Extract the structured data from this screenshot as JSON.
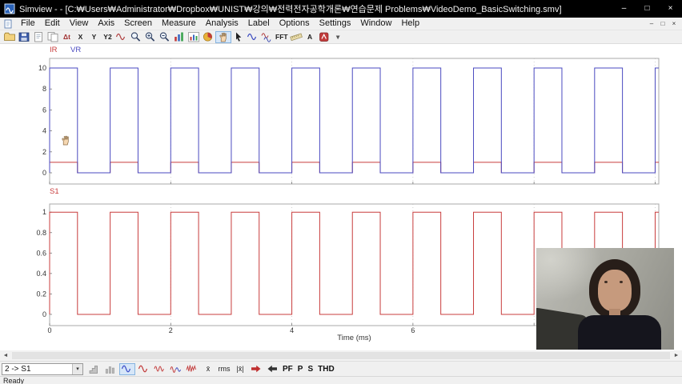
{
  "window": {
    "title": "Simview -  - [C:₩Users₩Administrator₩Dropbox₩UNIST₩강의₩전력전자공학개론₩연습문제 Problems₩VideoDemo_BasicSwitching.smv]",
    "controls": {
      "minimize": "–",
      "maximize": "□",
      "close": "×"
    }
  },
  "menubar": {
    "items": [
      "File",
      "Edit",
      "View",
      "Axis",
      "Screen",
      "Measure",
      "Analysis",
      "Label",
      "Options",
      "Settings",
      "Window",
      "Help"
    ],
    "mdi_controls": {
      "minimize": "–",
      "restore": "□",
      "close": "×"
    }
  },
  "toolbar": {
    "icons": [
      {
        "name": "open-icon",
        "kind": "folder"
      },
      {
        "name": "save-icon",
        "kind": "disk"
      },
      {
        "name": "print-icon",
        "kind": "page"
      },
      {
        "name": "copy-icon",
        "kind": "page2"
      },
      {
        "name": "measure-icon",
        "kind": "text",
        "label": "Δt",
        "color": "#a03030"
      },
      {
        "name": "x-axis-icon",
        "kind": "text",
        "label": "X",
        "color": "#202020"
      },
      {
        "name": "y-axis-icon",
        "kind": "text",
        "label": "Y",
        "color": "#202020"
      },
      {
        "name": "y2-axis-icon",
        "kind": "text",
        "label": "Y2",
        "color": "#202020"
      },
      {
        "name": "add-curve-icon",
        "kind": "wave",
        "color": "#b04040"
      },
      {
        "name": "zoom-icon",
        "kind": "mag"
      },
      {
        "name": "zoom-in-icon",
        "kind": "magplus"
      },
      {
        "name": "zoom-out-icon",
        "kind": "magminus"
      },
      {
        "name": "redraw-icon",
        "kind": "bars"
      },
      {
        "name": "add-screen-icon",
        "kind": "bars2"
      },
      {
        "name": "pie-view-icon",
        "kind": "pie"
      },
      {
        "name": "hand-pan-icon",
        "kind": "hand",
        "selected": true
      },
      {
        "name": "pointer-icon",
        "kind": "cursor"
      },
      {
        "name": "overlay-curve-icon",
        "kind": "wave",
        "color": "#3a4ac0"
      },
      {
        "name": "dual-curve-icon",
        "kind": "wave2"
      },
      {
        "name": "fft-icon",
        "kind": "text",
        "label": "FFT",
        "color": "#202020"
      },
      {
        "name": "ruler-icon",
        "kind": "ruler"
      },
      {
        "name": "text-label-icon",
        "kind": "text",
        "label": "A",
        "color": "#202020"
      },
      {
        "name": "phase-icon",
        "kind": "badge"
      },
      {
        "name": "toolbar-overflow-icon",
        "kind": "text",
        "label": "▾",
        "color": "#555555"
      }
    ]
  },
  "chart_data": [
    {
      "type": "line",
      "screen": "top",
      "title": "",
      "legend": [
        {
          "label": "IR",
          "color": "#c83c3c"
        },
        {
          "label": "VR",
          "color": "#4a4ac0"
        }
      ],
      "xlabel": "",
      "x_unit": "ms",
      "xlim": [
        0,
        10.06
      ],
      "ylim": [
        -1.07,
        10.92
      ],
      "yticks": [
        0,
        2,
        4,
        6,
        8,
        10
      ],
      "xticks": [
        0,
        2,
        4,
        6,
        8,
        10
      ],
      "grid_x": [
        2,
        4,
        6,
        8,
        10
      ],
      "series": [
        {
          "name": "IR",
          "color": "#c83c3c",
          "waveform": "square",
          "low": 0,
          "high": 1,
          "period_ms": 1.0,
          "duty": 0.46,
          "start_state": "high"
        },
        {
          "name": "VR",
          "color": "#4a4ac0",
          "waveform": "square",
          "low": 0,
          "high": 10,
          "period_ms": 1.0,
          "duty": 0.46,
          "start_state": "high"
        }
      ]
    },
    {
      "type": "line",
      "screen": "bottom",
      "title": "",
      "legend": [
        {
          "label": "S1",
          "color": "#c83c3c"
        }
      ],
      "xlabel": "Time (ms)",
      "x_unit": "ms",
      "xlim": [
        0,
        10.06
      ],
      "ylim": [
        -0.11,
        1.08
      ],
      "yticks": [
        0,
        0.2,
        0.4,
        0.6,
        0.8,
        1
      ],
      "xticks": [
        0,
        2,
        4,
        6,
        8,
        10
      ],
      "xtick_labels": [
        "0",
        "2",
        "4",
        "6"
      ],
      "grid_x": [
        2,
        4,
        6,
        8,
        10
      ],
      "series": [
        {
          "name": "S1",
          "color": "#c83c3c",
          "waveform": "square",
          "low": 0,
          "high": 1,
          "period_ms": 1.0,
          "duty": 0.46,
          "start_state": "high"
        }
      ]
    }
  ],
  "bottom_toolbar": {
    "combo": {
      "value": "2 -> S1",
      "dropdown_icon": "▾"
    },
    "icons": [
      {
        "name": "bar-display-icon",
        "kind": "graybars"
      },
      {
        "name": "stacked-display-icon",
        "kind": "graybars2"
      },
      {
        "name": "sine-display-icon",
        "kind": "sine",
        "color": "#3a4ac8",
        "selected": true
      },
      {
        "name": "waveform-red-icon",
        "kind": "sine",
        "color": "#c23a3a"
      },
      {
        "name": "waveform-double-icon",
        "kind": "sine2",
        "color": "#c23a3a"
      },
      {
        "name": "waveform-mixed-icon",
        "kind": "mixwave"
      },
      {
        "name": "waveform-noise-icon",
        "kind": "noise"
      },
      {
        "name": "mean-icon",
        "kind": "text",
        "label": "x̄"
      },
      {
        "name": "rms-icon",
        "kind": "text",
        "label": "rms"
      },
      {
        "name": "abs-mean-icon",
        "kind": "text",
        "label": "|x̄|"
      },
      {
        "name": "next-page-icon",
        "kind": "arrowR",
        "color": "#c03030"
      },
      {
        "name": "prev-page-icon",
        "kind": "arrowL",
        "color": "#333333"
      },
      {
        "name": "power-factor-button",
        "kind": "label",
        "label": "PF"
      },
      {
        "name": "real-power-button",
        "kind": "label",
        "label": "P"
      },
      {
        "name": "apparent-power-button",
        "kind": "label",
        "label": "S"
      },
      {
        "name": "thd-button",
        "kind": "label",
        "label": "THD"
      }
    ]
  },
  "scrollbar": {
    "left_arrow": "◄",
    "right_arrow": "►"
  },
  "statusbar": {
    "text": "Ready"
  },
  "cursor": {
    "name": "hand-cursor",
    "kind": "hand"
  },
  "colors": {
    "accent_red": "#c83c3c",
    "accent_blue": "#4a4ac0",
    "titlebar_bg": "#000000",
    "chrome_bg": "#f0f0f0"
  }
}
